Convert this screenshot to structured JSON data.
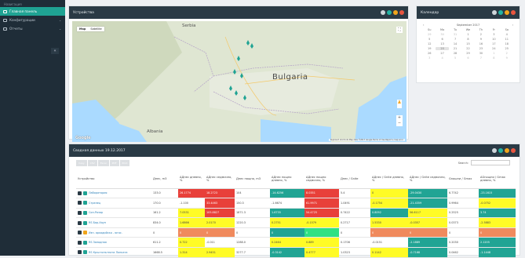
{
  "sidebar": {
    "header": "Навигация",
    "items": [
      {
        "label": "Главная панель",
        "icon": "monitor-icon",
        "active": true
      },
      {
        "label": "Конфигурации",
        "icon": "grid-icon",
        "active": false
      },
      {
        "label": "Отчеты",
        "icon": "report-icon",
        "active": false
      }
    ],
    "collapse_icon": "«"
  },
  "devices_panel": {
    "title": "Устройства",
    "map_tabs": [
      "Map",
      "Satellite"
    ],
    "labels": [
      {
        "text": "Serbia",
        "kind": "big-small"
      },
      {
        "text": "Bulgaria",
        "kind": "big"
      },
      {
        "text": "Albania",
        "kind": "cty"
      },
      {
        "text": "Google",
        "kind": "brand"
      }
    ],
    "attribution": "Keyboard shortcuts  Map data ©2017 Google  Terms of Use  Report a map error"
  },
  "calendar_panel": {
    "title": "Календар",
    "month": "September 2017",
    "weekdays": [
      "Su",
      "Mo",
      "Tu",
      "We",
      "Th",
      "Fr",
      "Sa"
    ],
    "rows": [
      [
        "29",
        "30",
        "31",
        "1",
        "2",
        "3",
        "4"
      ],
      [
        "5",
        "6",
        "7",
        "8",
        "9",
        "10",
        "11"
      ],
      [
        "12",
        "13",
        "14",
        "15",
        "16",
        "17",
        "18"
      ],
      [
        "19",
        "20",
        "21",
        "22",
        "23",
        "24",
        "25"
      ],
      [
        "26",
        "27",
        "28",
        "29",
        "30",
        "1",
        "2"
      ],
      [
        "3",
        "4",
        "5",
        "6",
        "7",
        "8",
        "9"
      ]
    ],
    "today": "20"
  },
  "table_panel": {
    "title": "Сводная данных 19.12.2017",
    "buttons": [
      "Copy",
      "CSV",
      "Excel",
      "PDF",
      "Print"
    ],
    "search_label": "Search:",
    "columns": [
      "Устройство",
      "Днес, m3",
      "ΔДнес дневно, %",
      "ΔДнес седмично, %",
      "Днес нощно, m3",
      "ΔДнес нощно дневно, %",
      "ΔДнес нощно седмично, %",
      "Днес / Gnite",
      "ΔДнес / Gnite дневно, %",
      "ΔДнес / Gnite седмично, %",
      "Gnoшни / Gmax",
      "ΔGnoщни / Gmax дневно, %"
    ],
    "rows": [
      {
        "name": "Лаборатория",
        "icon": "#1fa393",
        "cells": [
          "133.0",
          "26.1774",
          "18.2723",
          "104",
          "-14.6256",
          "8.0351",
          "5.4",
          "0",
          "-29.0430",
          "6.7742",
          "-23.1615"
        ],
        "colors": [
          "",
          "red",
          "red",
          "",
          "tea",
          "red",
          "",
          "yel",
          "tea",
          "",
          "tea"
        ]
      },
      {
        "name": "Стрелец",
        "icon": "#1fa393",
        "cells": [
          "170.0",
          "-1.100",
          "33.4463",
          "150.3",
          "-1.6674",
          "61.9971",
          "1.0491",
          "-0.1754",
          "-21.4359",
          "0.9964",
          "-0.0752"
        ],
        "colors": [
          "",
          "",
          "red",
          "",
          "",
          "red",
          "",
          "yel",
          "tea",
          "",
          "yel"
        ]
      },
      {
        "name": "Сон-Разар",
        "icon": "#1fa393",
        "cells": [
          "161.2",
          "7.0531",
          "105.8827",
          "1871.3",
          "1.6735",
          "54.4725",
          "0.7422",
          "0.8092",
          "56.6117",
          "0.2525",
          "3.74"
        ],
        "colors": [
          "",
          "yel",
          "red",
          "",
          "tea",
          "red",
          "",
          "tea",
          "yel",
          "",
          "tea"
        ]
      },
      {
        "name": "RS Бар-Хаун",
        "icon": "#1fa393",
        "cells": [
          "834.0",
          "1.6866",
          "2.0170",
          "1220.3",
          "0.2751",
          "-0.1579",
          "0.2717",
          "1.5330",
          "-0.0357",
          "0.0373",
          "-2.5883"
        ],
        "colors": [
          "",
          "yel",
          "yel",
          "",
          "yel",
          "yel",
          "",
          "yel",
          "yel",
          "",
          "yel"
        ]
      },
      {
        "name": "Изп. аркадийско - югос.",
        "icon": "#f0a51c",
        "cells": [
          "0",
          "0",
          "0",
          "0",
          "0",
          "0",
          "0",
          "0",
          "0",
          "0",
          "0"
        ],
        "colors": [
          "",
          "ora",
          "ora",
          "",
          "tea",
          "grn",
          "",
          "ora",
          "ora",
          "",
          "ora"
        ]
      },
      {
        "name": "RS Западная",
        "icon": "#1fa393",
        "cells": [
          "611.2",
          "0.722",
          "-0.011",
          "1288.0",
          "0.2464",
          "0.889",
          "0.1706",
          "-0.0151",
          "-2.1889",
          "0.2030",
          "2.1205"
        ],
        "colors": [
          "",
          "yel",
          "",
          "",
          "yel",
          "yel",
          "",
          "",
          "tea",
          "",
          "tea"
        ]
      },
      {
        "name": "RS Кръстопътната Лопката",
        "icon": "#1fa393",
        "cells": [
          "1668.5",
          "1.314",
          "2.9451",
          "3277.7",
          "-0.3142",
          "0.4777",
          "1.0323",
          "0.1142",
          "-0.7168",
          "0.0462",
          "-1.1448"
        ],
        "colors": [
          "",
          "yel",
          "yel",
          "",
          "tea",
          "yel",
          "",
          "yel",
          "tea",
          "",
          "tea"
        ]
      }
    ]
  }
}
